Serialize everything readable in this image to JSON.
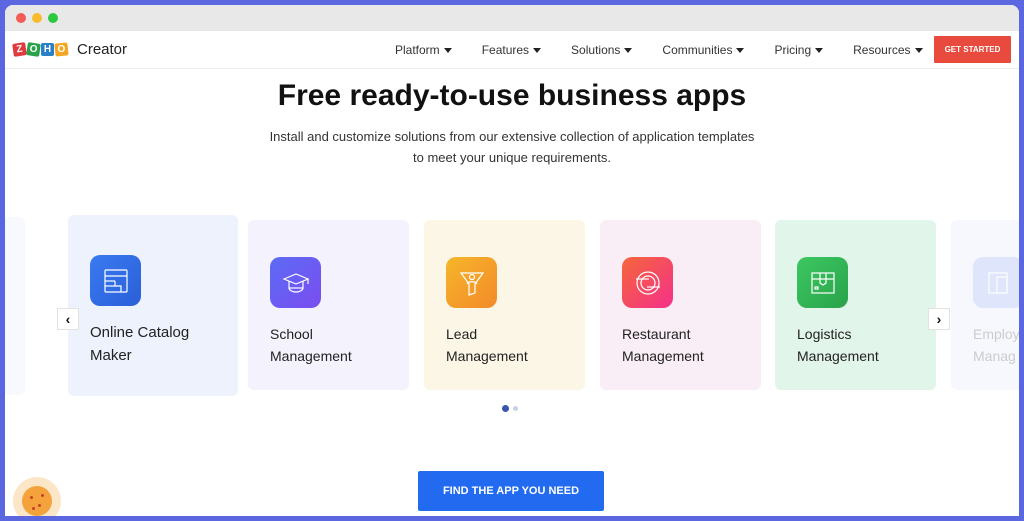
{
  "browser": {
    "controls": [
      "close",
      "minimize",
      "maximize"
    ]
  },
  "header": {
    "logo_letters": [
      "Z",
      "O",
      "H",
      "O"
    ],
    "product_name": "Creator",
    "nav": [
      {
        "label": "Platform",
        "icon": "caret-down-icon"
      },
      {
        "label": "Features",
        "icon": "caret-down-icon"
      },
      {
        "label": "Solutions",
        "icon": "caret-down-icon"
      },
      {
        "label": "Communities",
        "icon": "caret-down-icon"
      },
      {
        "label": "Pricing",
        "icon": "caret-down-icon"
      },
      {
        "label": "Resources",
        "icon": "caret-down-icon"
      }
    ],
    "cta_label": "GET STARTED",
    "cta_color": "#e84a3e"
  },
  "hero": {
    "title": "Free ready-to-use business apps",
    "subtitle": "Install and customize solutions from our extensive collection of application templates to meet your unique requirements."
  },
  "carousel": {
    "prev_icon": "‹",
    "next_icon": "›",
    "cards": [
      {
        "line1": "Online Catalog",
        "line2": "Maker",
        "icon": "catalog-icon",
        "bg": "#eef2fd",
        "icon_bg": "#3a6fe8"
      },
      {
        "line1": "School",
        "line2": "Management",
        "icon": "graduation-cap-icon",
        "bg": "#f4f2fd",
        "icon_bg": "#6a5cf0"
      },
      {
        "line1": "Lead",
        "line2": "Management",
        "icon": "funnel-user-icon",
        "bg": "#fbf6e6",
        "icon_bg": "#f4a22a"
      },
      {
        "line1": "Restaurant",
        "line2": "Management",
        "icon": "plate-icon",
        "bg": "#faeef6",
        "icon_bg": "#f54b7a"
      },
      {
        "line1": "Logistics",
        "line2": "Management",
        "icon": "package-icon",
        "bg": "#e2f5eb",
        "icon_bg": "#34b85a"
      },
      {
        "line1": "Employ",
        "line2": "Manag",
        "icon": "employee-icon",
        "bg": "#f7f8fe",
        "icon_bg": "#dfe5fb"
      }
    ],
    "pages": 2,
    "active_page": 1
  },
  "cta": {
    "label": "FIND THE APP YOU NEED",
    "color": "#226bf0"
  },
  "cookie": {
    "icon": "cookie-icon"
  }
}
